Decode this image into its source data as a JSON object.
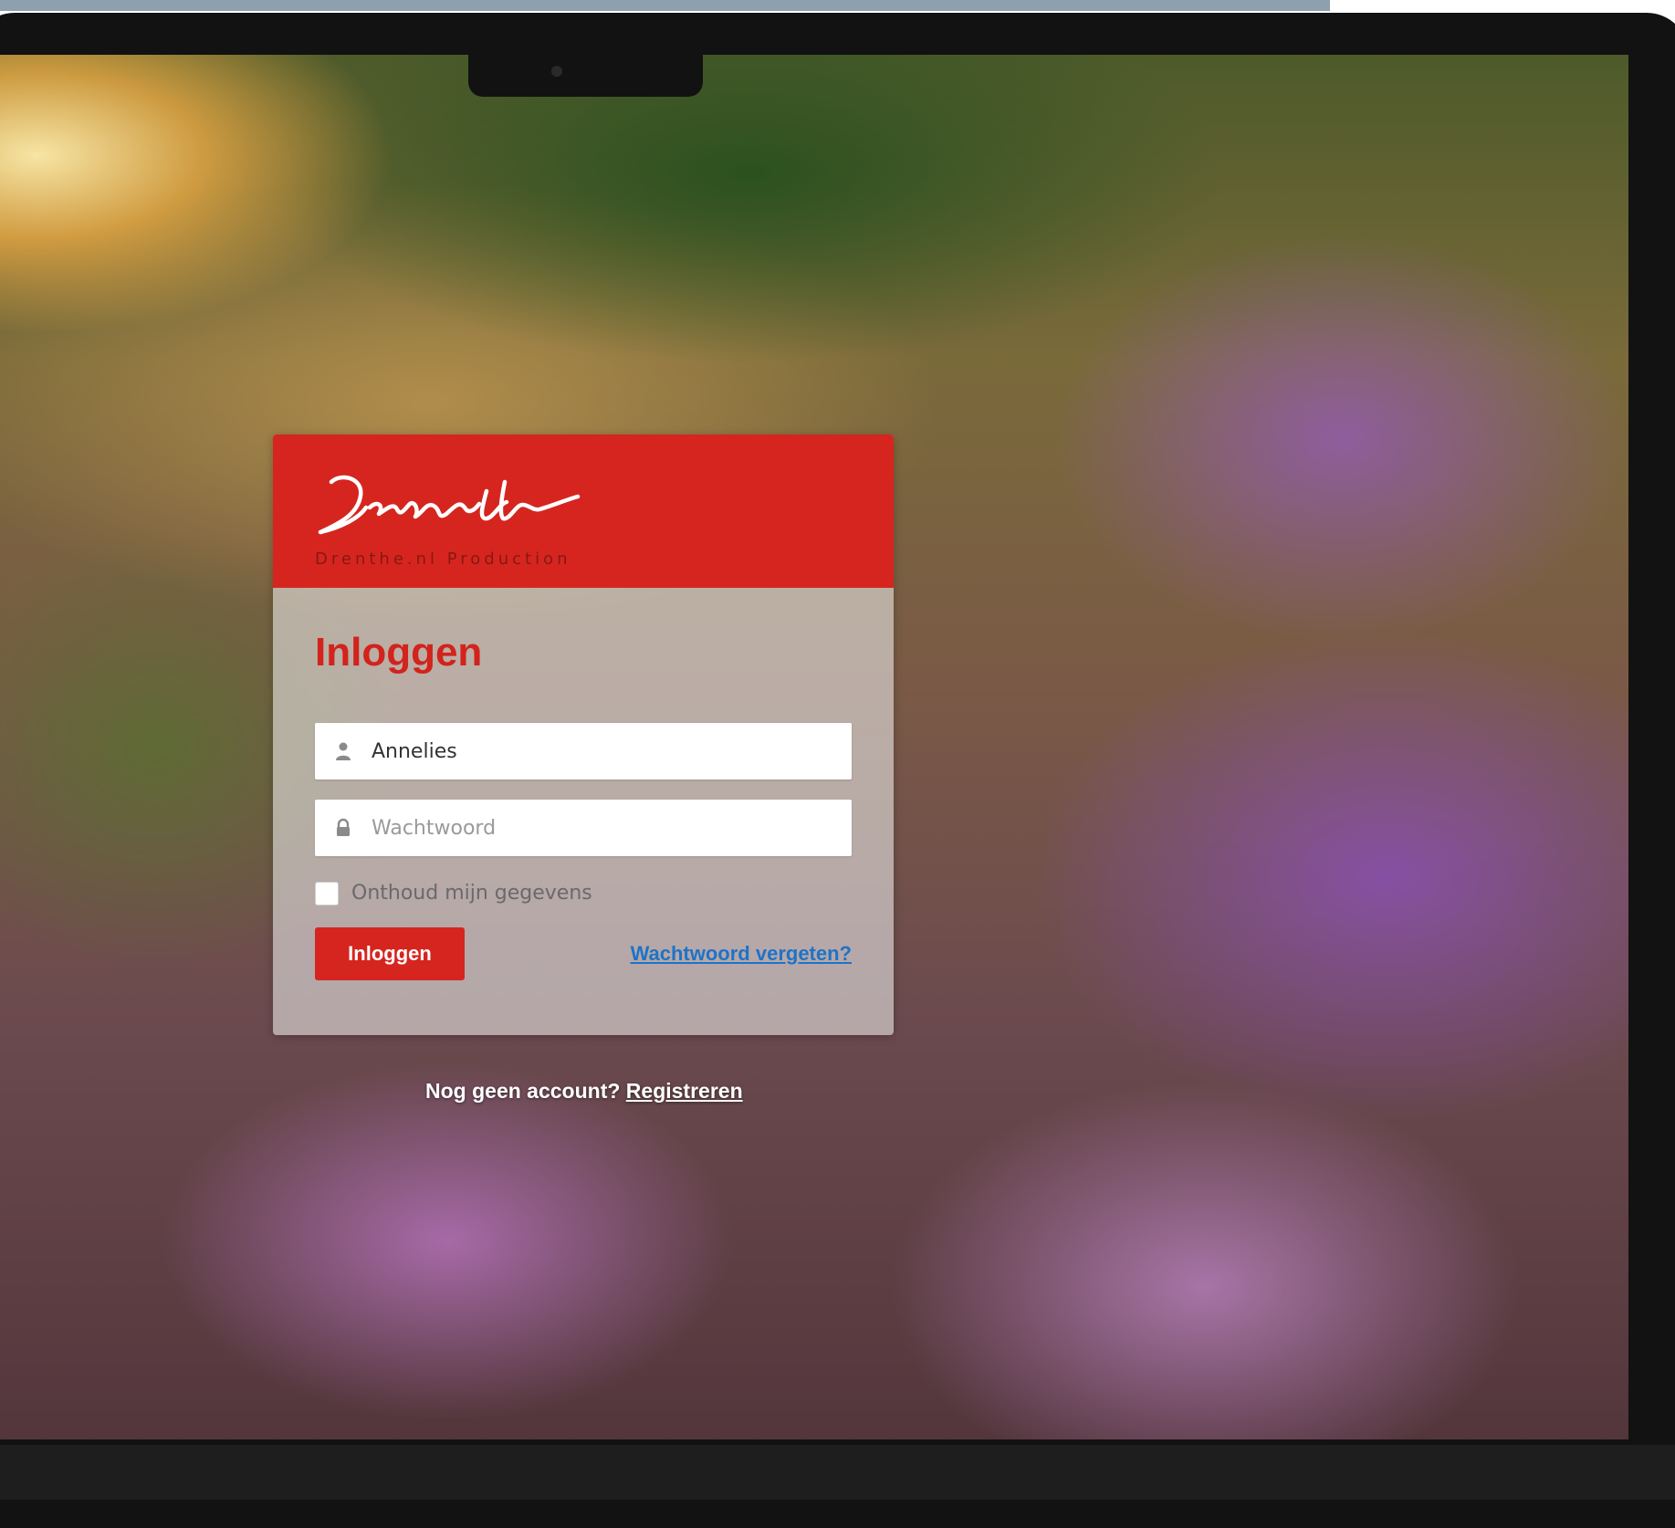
{
  "brand": {
    "logo_text": "Drenthe",
    "tagline": "Drenthe.nl Production",
    "color": "#d6251f"
  },
  "login": {
    "title": "Inloggen",
    "username_value": "Annelies",
    "password_placeholder": "Wachtwoord",
    "remember_label": "Onthoud mijn gegevens",
    "submit_label": "Inloggen",
    "forgot_label": "Wachtwoord vergeten?",
    "link_color": "#1e73c8"
  },
  "footer": {
    "prompt": "Nog geen account?",
    "register_label": "Registreren"
  },
  "icons": {
    "user": "user-icon",
    "lock": "lock-icon"
  }
}
